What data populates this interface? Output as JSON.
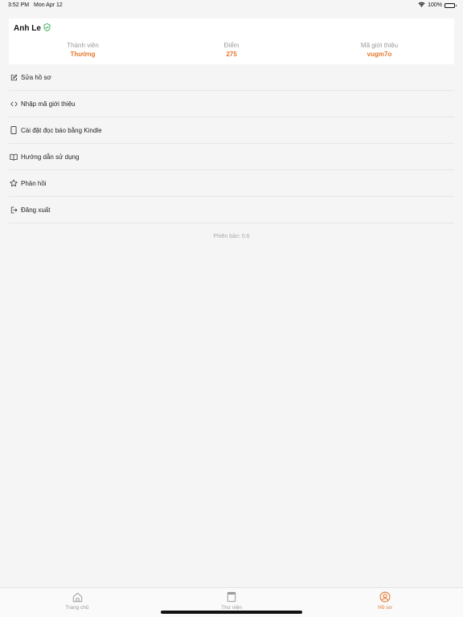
{
  "status_bar": {
    "time": "3:52 PM",
    "date": "Mon Apr 12",
    "battery": "100%"
  },
  "profile": {
    "name": "Anh Le",
    "verified_color": "#2aa84a",
    "stats": [
      {
        "label": "Thành viên",
        "value": "Thường"
      },
      {
        "label": "Điểm",
        "value": "275"
      },
      {
        "label": "Mã giới thiệu",
        "value": "vugm7o"
      }
    ]
  },
  "menu": [
    {
      "icon": "edit-icon",
      "label": "Sửa hồ sơ"
    },
    {
      "icon": "code-icon",
      "label": "Nhập mã giới thiệu"
    },
    {
      "icon": "tablet-icon",
      "label": "Cài đặt đọc báo bằng Kindle"
    },
    {
      "icon": "book-open-icon",
      "label": "Hướng dẫn sử dụng"
    },
    {
      "icon": "star-icon",
      "label": "Phản hồi"
    },
    {
      "icon": "logout-icon",
      "label": "Đăng xuất"
    }
  ],
  "version": "Phiên bản: 0.6",
  "tabs": [
    {
      "icon": "home-icon",
      "label": "Trang chủ",
      "active": false
    },
    {
      "icon": "library-icon",
      "label": "Thư viện",
      "active": false
    },
    {
      "icon": "profile-icon",
      "label": "Hồ sơ",
      "active": true
    }
  ],
  "colors": {
    "accent": "#e5772c",
    "background": "#f5f5f5"
  }
}
